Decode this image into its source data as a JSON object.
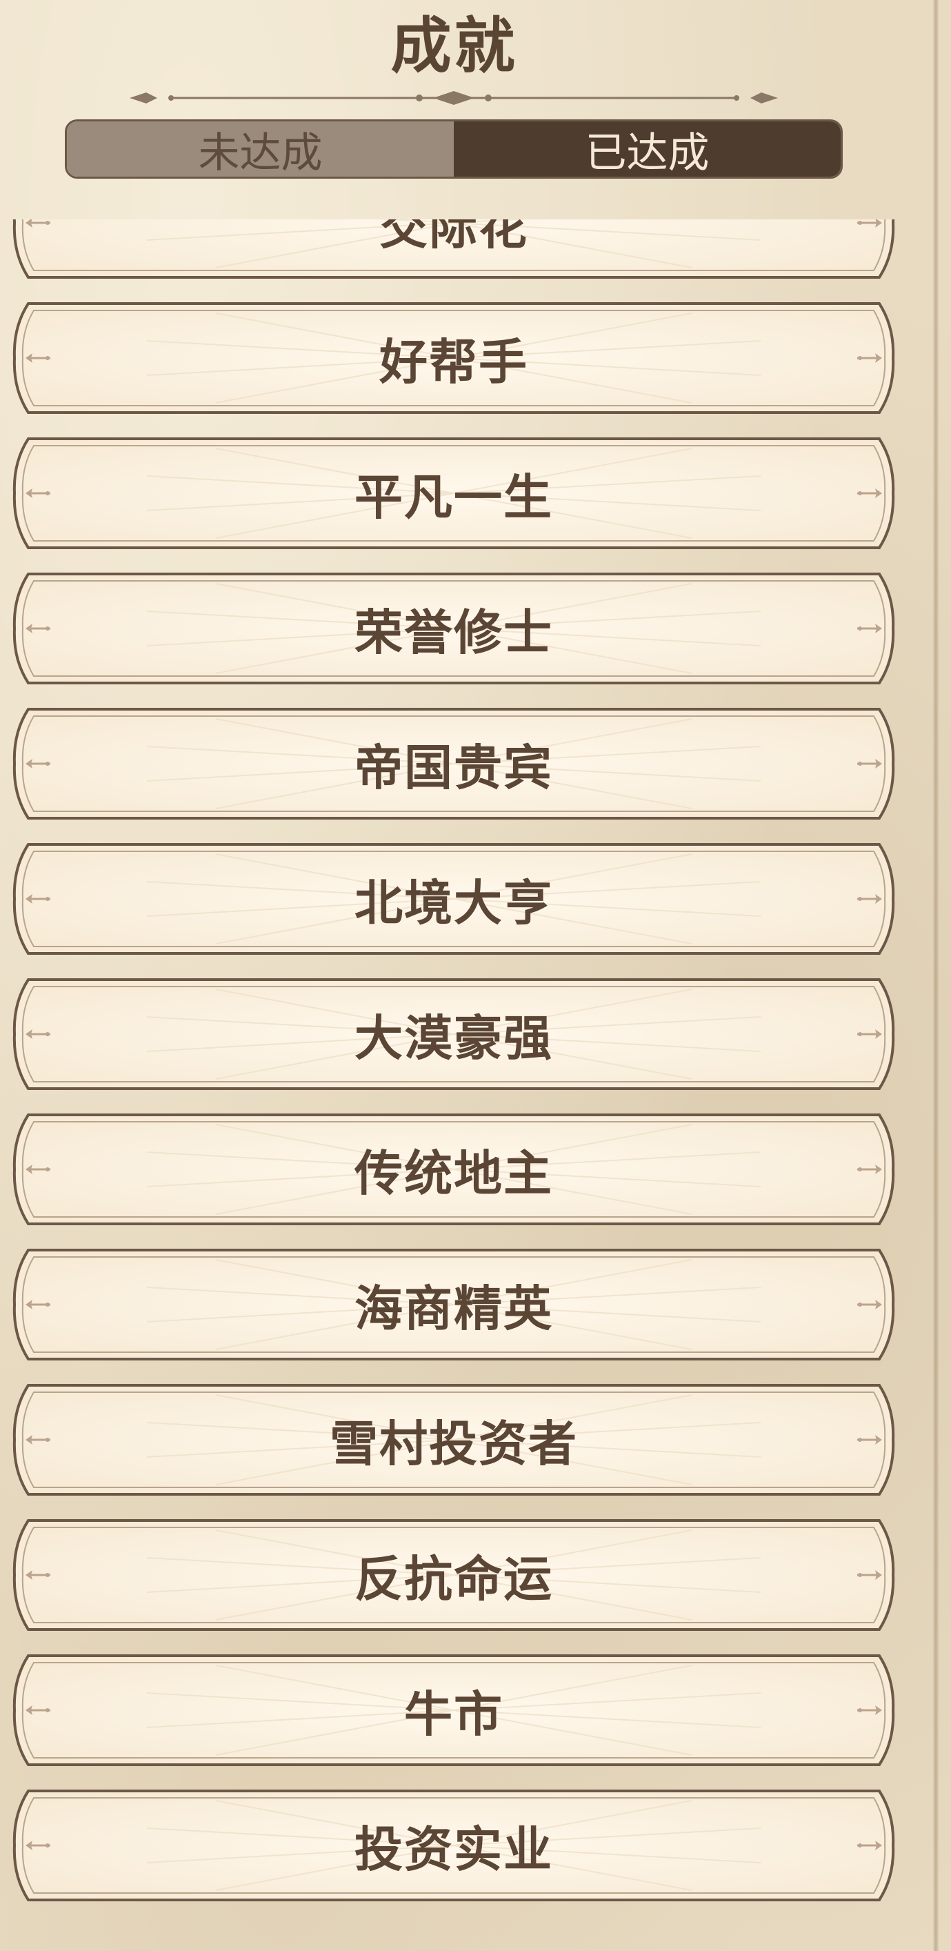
{
  "header": {
    "title": "成就",
    "tabs": [
      {
        "label": "未达成",
        "active": false
      },
      {
        "label": "已达成",
        "active": true
      }
    ]
  },
  "achievements": [
    {
      "name": "交际花"
    },
    {
      "name": "好帮手"
    },
    {
      "name": "平凡一生"
    },
    {
      "name": "荣誉修士"
    },
    {
      "name": "帝国贵宾"
    },
    {
      "name": "北境大亨"
    },
    {
      "name": "大漠豪强"
    },
    {
      "name": "传统地主"
    },
    {
      "name": "海商精英"
    },
    {
      "name": "雪村投资者"
    },
    {
      "name": "反抗命运"
    },
    {
      "name": "牛市"
    },
    {
      "name": "投资实业"
    }
  ],
  "colors": {
    "background": "#e8dbc2",
    "card_fill": "#fbf1e1",
    "card_border": "#6d5847",
    "text": "#5b4535",
    "tab_active": "#4e3d2f",
    "tab_inactive": "#9b8b7c"
  },
  "icons": [
    "divider-ornament",
    "arrow-ornament-left",
    "arrow-ornament-right"
  ]
}
